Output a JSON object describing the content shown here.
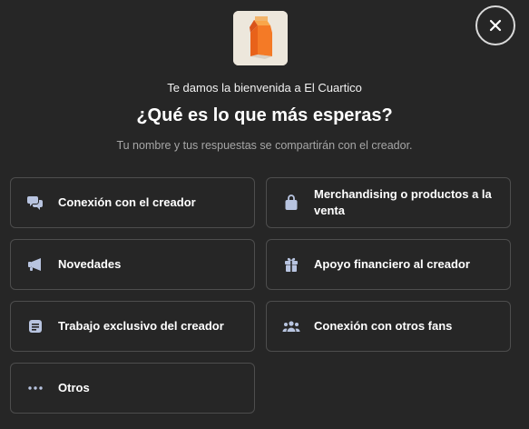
{
  "modal": {
    "welcome": "Te damos la bienvenida a El Cuartico",
    "title": "¿Qué es lo que más esperas?",
    "subtitle": "Tu nombre y tus respuestas se compartirán con el creador.",
    "close_icon": "close-icon",
    "logo_icon": "milk-carton-logo"
  },
  "options": [
    {
      "label": "Conexión con el creador",
      "icon": "chat-bubbles-icon"
    },
    {
      "label": "Merchandising o productos a la venta",
      "icon": "shopping-bag-icon"
    },
    {
      "label": "Novedades",
      "icon": "megaphone-icon"
    },
    {
      "label": "Apoyo financiero al creador",
      "icon": "gift-icon"
    },
    {
      "label": "Trabajo exclusivo del creador",
      "icon": "document-icon"
    },
    {
      "label": "Conexión con otros fans",
      "icon": "people-icon"
    },
    {
      "label": "Otros",
      "icon": "ellipsis-icon"
    }
  ],
  "colors": {
    "background": "#262626",
    "border": "#4d4d4d",
    "icon": "#b8c4e0",
    "text": "#ffffff",
    "muted": "#a6a6a6"
  }
}
